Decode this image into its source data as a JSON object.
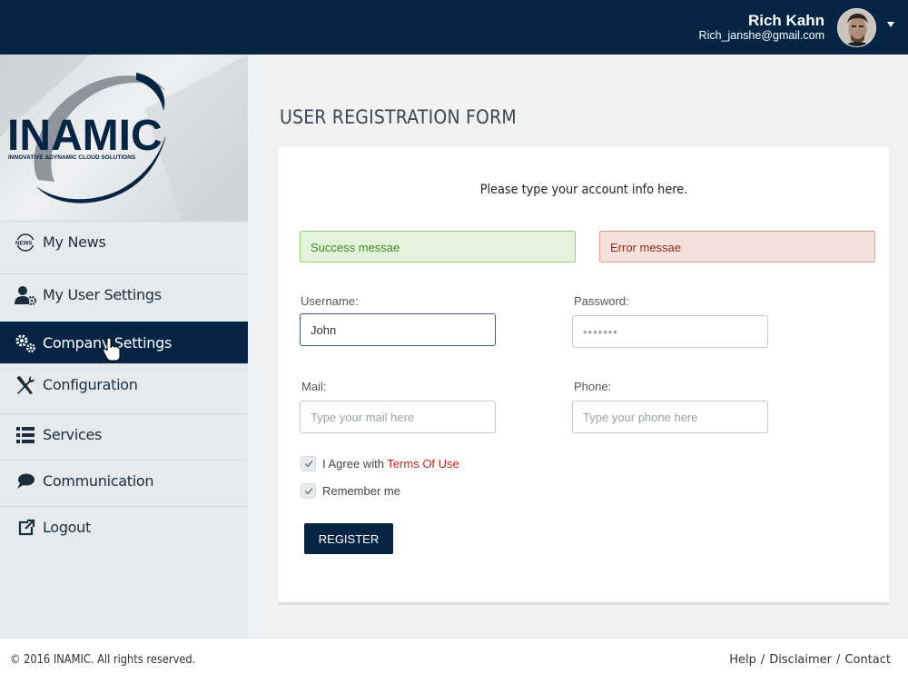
{
  "header": {
    "user_name": "Rich Kahn",
    "user_email": "Rich_janshe@gmail.com"
  },
  "brand": {
    "logo_text": "INAMIC",
    "tagline": "INNOVATIVE &DYNAMIC CLOUD SOLUTIONS",
    "primary_color": "#062545"
  },
  "sidebar": {
    "items": [
      {
        "label": "My News",
        "icon": "news-icon"
      },
      {
        "label": "My User Settings",
        "icon": "user-settings-icon"
      },
      {
        "label": "Company Settings",
        "icon": "gears-icon",
        "active": true
      },
      {
        "label": "Configuration",
        "icon": "wrench-screwdriver-icon"
      },
      {
        "label": "Services",
        "icon": "list-icon"
      },
      {
        "label": "Communication",
        "icon": "chat-bubble-icon"
      },
      {
        "label": "Logout",
        "icon": "external-link-icon"
      }
    ]
  },
  "main": {
    "title": "USER REGISTRATION FORM",
    "instructions": "Please type your account info here.",
    "success_message": "Success messae",
    "error_message": "Error messae",
    "form": {
      "username_label": "Username:",
      "username_value": "John",
      "password_label": "Password:",
      "password_value": "•••••••",
      "mail_label": "Mail:",
      "mail_placeholder": "Type your mail here",
      "phone_label": "Phone:",
      "phone_placeholder": "Type your phone here",
      "agree_prefix": "I Agree with ",
      "terms_link": "Terms Of Use",
      "remember_label": "Remember me",
      "register_button": "REGISTER"
    }
  },
  "footer": {
    "copyright": "© 2016 INAMIC. All rights reserved.",
    "links": [
      "Help",
      "Disclaimer",
      "Contact"
    ],
    "separator": "/"
  }
}
